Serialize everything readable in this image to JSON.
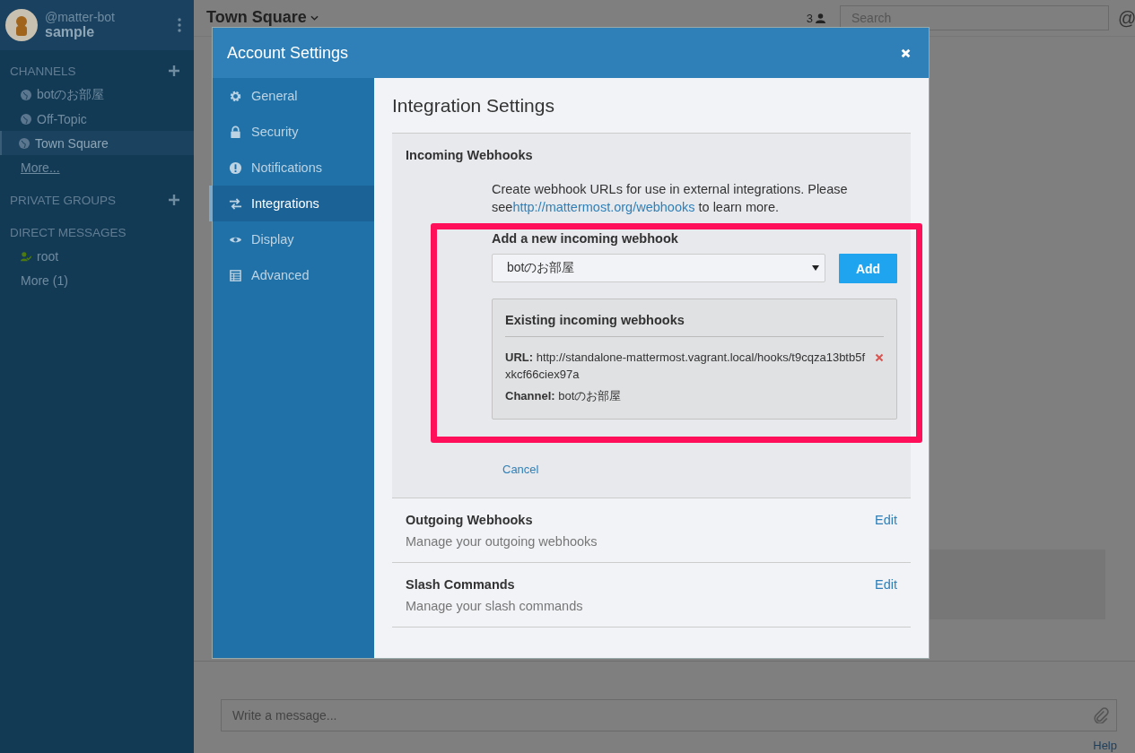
{
  "sidebar": {
    "user": {
      "handle": "@matter-bot",
      "team": "sample"
    },
    "sections": [
      {
        "title": "CHANNELS",
        "addable": true,
        "items": [
          {
            "label": "botのお部屋",
            "kind": "channel",
            "selected": false
          },
          {
            "label": "Off-Topic",
            "kind": "channel",
            "selected": false
          },
          {
            "label": "Town Square",
            "kind": "channel",
            "selected": true
          },
          {
            "label": "More...",
            "kind": "more",
            "selected": false
          }
        ]
      },
      {
        "title": "PRIVATE GROUPS",
        "addable": true
      },
      {
        "title": "DIRECT MESSAGES",
        "addable": false,
        "items": [
          {
            "label": "root",
            "kind": "user",
            "selected": false
          },
          {
            "label": "More (1)",
            "kind": "plain",
            "selected": false
          }
        ]
      }
    ]
  },
  "channel_header": {
    "title": "Town Square",
    "member_count": "3",
    "search": {
      "placeholder": "Search"
    },
    "mention": "@"
  },
  "modal": {
    "title": "Account Settings",
    "nav": [
      {
        "label": "General",
        "kind": "gear",
        "selected": false
      },
      {
        "label": "Security",
        "kind": "lock",
        "selected": false
      },
      {
        "label": "Notifications",
        "kind": "alert",
        "selected": false
      },
      {
        "label": "Integrations",
        "kind": "exchange",
        "selected": true
      },
      {
        "label": "Display",
        "kind": "eye",
        "selected": false
      },
      {
        "label": "Advanced",
        "kind": "table",
        "selected": false
      }
    ],
    "content": {
      "title": "Integration Settings",
      "sections": [
        {
          "kind": "expanded",
          "title": "Incoming Webhooks",
          "description_before": "Create webhook URLs for use in external integrations. Please see",
          "link": "http://mattermost.org/webhooks",
          "description_after": " to learn more.",
          "add_label": "Add a new incoming webhook",
          "select": {
            "value": "botのお部屋"
          },
          "add_button": "Add",
          "existing": {
            "title": "Existing incoming webhooks",
            "hooks": [
              {
                "url_label": "URL:",
                "url": "http://standalone-mattermost.vagrant.local/hooks/t9cqza13btb5fxkcf66ciex97a",
                "channel_label": "Channel:",
                "channel": "botのお部屋"
              }
            ]
          },
          "cancel": "Cancel"
        },
        {
          "kind": "collapsed",
          "title": "Outgoing Webhooks",
          "description": "Manage your outgoing webhooks",
          "edit": "Edit"
        },
        {
          "kind": "collapsed",
          "title": "Slash Commands",
          "description": "Manage your slash commands",
          "edit": "Edit"
        }
      ]
    }
  },
  "composer": {
    "placeholder": "Write a message...",
    "help": "Help"
  }
}
